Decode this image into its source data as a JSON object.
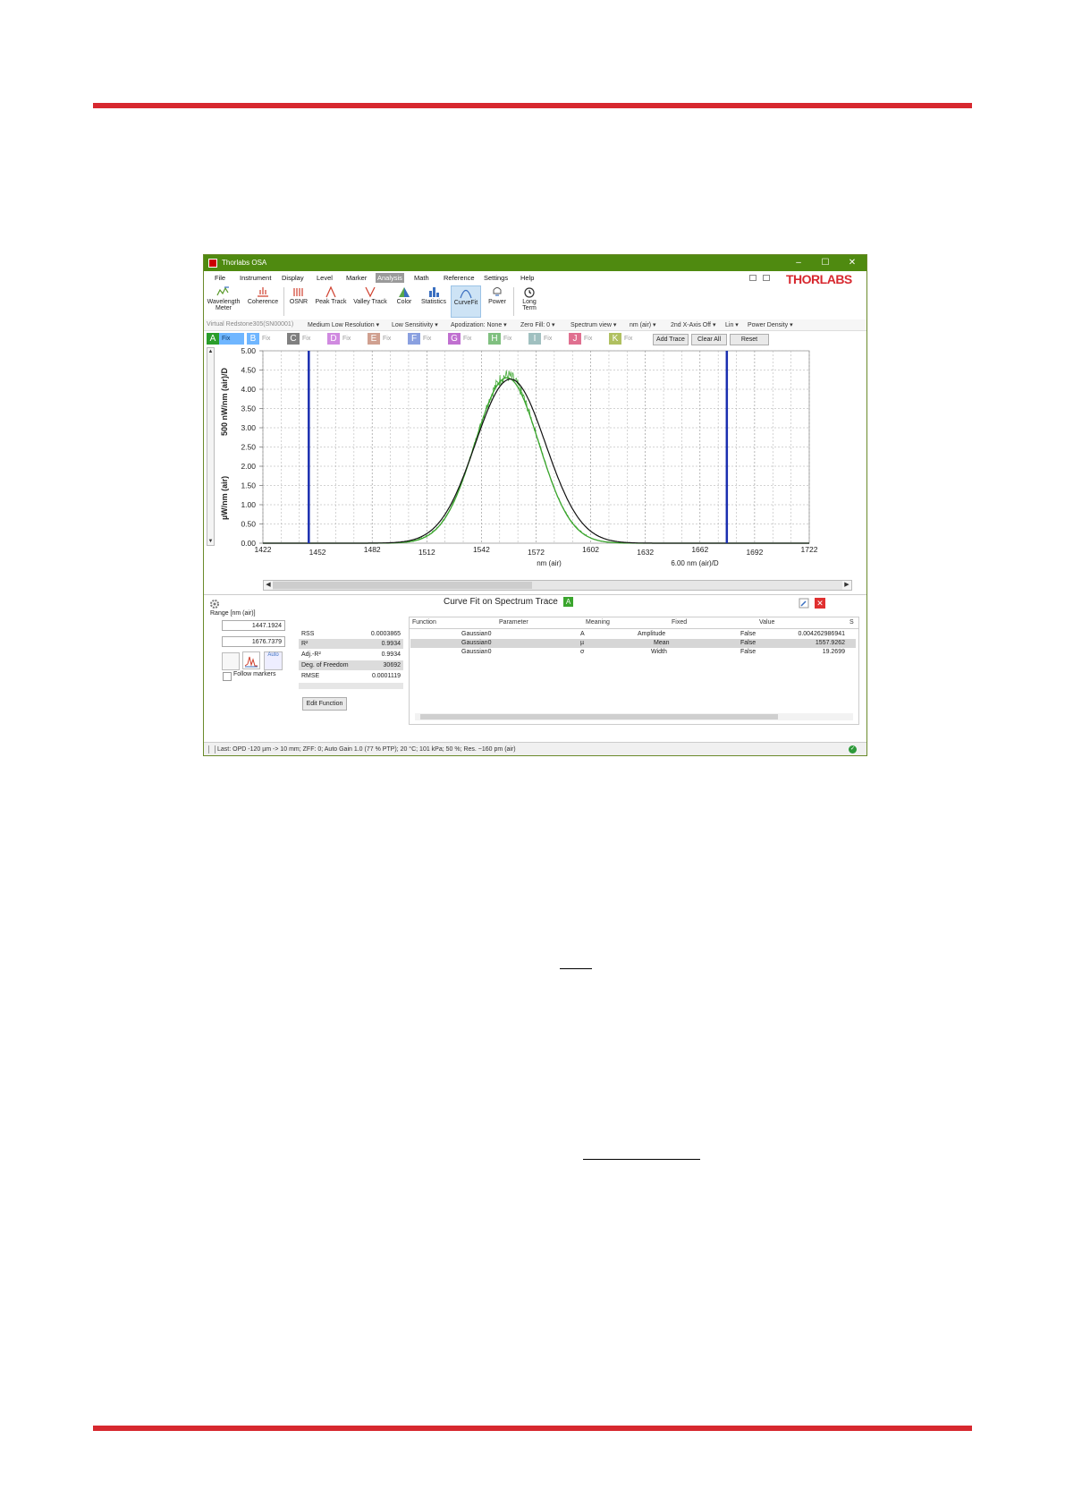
{
  "window": {
    "title": "Thorlabs OSA",
    "controls": [
      "–",
      "☐",
      "✕"
    ],
    "logo": "THORLABS"
  },
  "menu": [
    "File",
    "Instrument",
    "Display",
    "Level",
    "Marker",
    "Analysis",
    "Math",
    "Reference",
    "Settings",
    "Help"
  ],
  "toolbar": [
    {
      "label": "Wavelength Meter",
      "icon": "wavelength-meter-icon"
    },
    {
      "label": "Coherence",
      "icon": "coherence-icon"
    },
    {
      "label": "OSNR",
      "icon": "osnr-icon"
    },
    {
      "label": "Peak Track",
      "icon": "peak-track-icon"
    },
    {
      "label": "Valley Track",
      "icon": "valley-track-icon"
    },
    {
      "label": "Color",
      "icon": "color-icon"
    },
    {
      "label": "Statistics",
      "icon": "statistics-icon"
    },
    {
      "label": "CurveFit",
      "icon": "curvefit-icon"
    },
    {
      "label": "Power",
      "icon": "power-icon"
    },
    {
      "label": "Long Term",
      "icon": "long-term-icon"
    }
  ],
  "settings": [
    "Virtual Redstone305(SN00001)",
    "Medium Low Resolution ▾",
    "Low Sensitivity ▾",
    "Apodization: None ▾",
    "Zero Fill: 0 ▾",
    "Spectrum view ▾",
    "nm (air) ▾",
    "2nd X-Axis Off ▾",
    "Lin ▾",
    "Power Density ▾"
  ],
  "traces": {
    "letters": [
      "A",
      "B",
      "C",
      "D",
      "E",
      "F",
      "G",
      "H",
      "I",
      "J",
      "K"
    ],
    "fix_label": "Fix",
    "colors": [
      "#2a9d2a",
      "#6fb6ff",
      "#808080",
      "#d08ae0",
      "#d0a090",
      "#8aa0e0",
      "#c070d0",
      "#80c080",
      "#a0c0c0",
      "#e07090",
      "#b0c060"
    ]
  },
  "buttons": {
    "add_trace": "Add Trace",
    "clear_all": "Clear All",
    "reset": "Reset"
  },
  "chart_data": {
    "type": "line",
    "ylabel": "µW/nm (air)",
    "ylabel_secondary": "500 nW/nm (air)/D",
    "xlabel": "nm (air)",
    "xlabel_secondary": "6.00 nm (air)/D",
    "xlim": [
      1422,
      1722
    ],
    "ylim": [
      0,
      5
    ],
    "xticks": [
      1422,
      1452,
      1482,
      1512,
      1542,
      1572,
      1602,
      1632,
      1662,
      1692,
      1722
    ],
    "yticks": [
      "0.00",
      "0.50",
      "1.00",
      "1.50",
      "2.00",
      "2.50",
      "3.00",
      "3.50",
      "4.00",
      "4.50",
      "5.00"
    ],
    "markers_nm": [
      1447.1924,
      1676.7379
    ],
    "series": [
      {
        "color": "#3aa52d",
        "gaussian": {
          "amplitude": 4.3,
          "mean": 1556,
          "sigma": 17.5
        },
        "noise_peak": 4.65
      },
      {
        "color": "#111111",
        "gaussian": {
          "amplitude": 4.262986941,
          "mean": 1557.9262,
          "sigma": 19.2699
        }
      }
    ]
  },
  "panel": {
    "title": "Curve Fit on Spectrum Trace",
    "trace_badge": "A",
    "range_label": "Range [nm (air)]",
    "range_from": "1447.1924",
    "range_to": "1676.7379",
    "auto_label": "Auto",
    "follow_markers": "Follow markers",
    "stats": [
      {
        "k": "RSS",
        "v": "0.0003865"
      },
      {
        "k": "R²",
        "v": "0.9934"
      },
      {
        "k": "Adj.-R²",
        "v": "0.9934"
      },
      {
        "k": "Deg. of Freedom",
        "v": "30692"
      },
      {
        "k": "RMSE",
        "v": "0.0001119"
      }
    ],
    "edit_function": "Edit Function",
    "table_headers": [
      "Function",
      "Parameter",
      "Meaning",
      "Fixed",
      "Value",
      "S"
    ],
    "rows": [
      [
        "Gaussian0",
        "A",
        "Amplitude",
        "False",
        "0.004262986941"
      ],
      [
        "Gaussian0",
        "µ",
        "Mean",
        "False",
        "1557.9262"
      ],
      [
        "Gaussian0",
        "σ",
        "Width",
        "False",
        "19.2699"
      ]
    ]
  },
  "status": "Last: OPD -120 µm -> 10 mm; ZFF: 0; Auto Gain 1.0 (77 % PTP); 20 °C; 101 kPa; 50 %; Res. ~160 pm (air)"
}
